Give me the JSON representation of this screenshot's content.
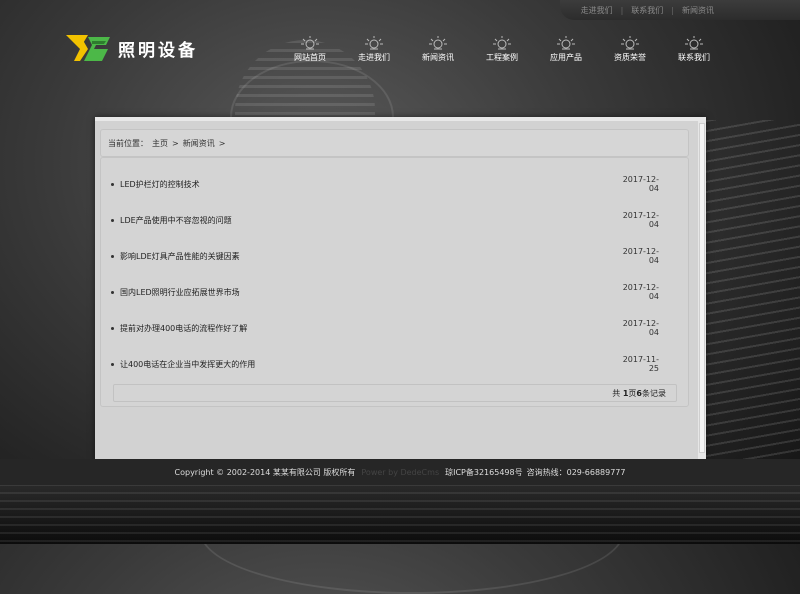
{
  "topbar": {
    "links": [
      "走进我们",
      "联系我们",
      "新闻资讯"
    ]
  },
  "logo": {
    "mark_text": "YB",
    "text": "照明设备",
    "colors": {
      "yellow": "#f2c200",
      "green": "#4cb848"
    }
  },
  "nav": {
    "items": [
      "网站首页",
      "走进我们",
      "新闻资讯",
      "工程案例",
      "应用产品",
      "资质荣誉",
      "联系我们"
    ],
    "icon": "lightbulb-icon"
  },
  "breadcrumb": {
    "label": "当前位置：",
    "home": "主页",
    "separator": ">",
    "current": "新闻资讯",
    "trailing": ">"
  },
  "news": [
    {
      "title": "LED护栏灯的控制技术",
      "date": "2017-12-04"
    },
    {
      "title": "LDE产品使用中不容忽视的问题",
      "date": "2017-12-04"
    },
    {
      "title": "影响LDE灯具产品性能的关键因素",
      "date": "2017-12-04"
    },
    {
      "title": "国内LED照明行业应拓展世界市场",
      "date": "2017-12-04"
    },
    {
      "title": "提前对办理400电话的流程作好了解",
      "date": "2017-12-04"
    },
    {
      "title": "让400电话在企业当中发挥更大的作用",
      "date": "2017-11-25"
    }
  ],
  "pager": {
    "prefix": "共",
    "pages": "1",
    "pages_suffix": "页",
    "records": "6",
    "records_suffix": "条记录"
  },
  "footer": {
    "copyright": "Copyright © 2002-2014 某某有限公司 版权所有",
    "powered": "Power by DedeCms",
    "icp": "琼ICP备32165498号",
    "hotline": "咨询热线：029-66889777"
  }
}
